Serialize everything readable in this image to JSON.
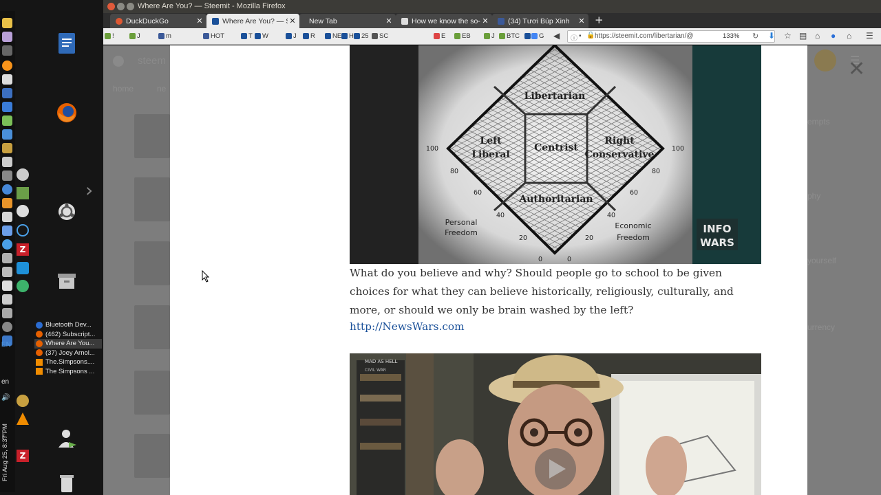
{
  "window": {
    "title": "Where Are You? — Steemit - Mozilla Firefox"
  },
  "tabs": [
    {
      "label": "DuckDuckGo",
      "favicon_color": "#de5833",
      "active": false
    },
    {
      "label": "Where Are You? — Ste",
      "favicon_color": "#1a5099",
      "active": true
    },
    {
      "label": "New Tab",
      "favicon_color": "",
      "active": false
    },
    {
      "label": "How we know the so-c",
      "favicon_color": "#dddddd",
      "active": false
    },
    {
      "label": "(34) Tươi Búp Xinh",
      "favicon_color": "#3b5998",
      "active": false
    }
  ],
  "bookmarks": [
    "!",
    "J",
    "m",
    "HOT",
    "T",
    "W",
    "J",
    "R",
    "NEW",
    "H",
    "25",
    "SC",
    "E",
    "EB",
    "J",
    "BTC",
    "G",
    "G"
  ],
  "urlbar": {
    "url": "https://steemit.com/libertarian/@",
    "zoom": "133%"
  },
  "post": {
    "paragraph": "What do you believe and why? Should people go to school to be given choices for what they can believe historically, religiously, culturally, and more, or should we only be brain washed by the left?",
    "link": "http://NewsWars.com"
  },
  "figure1": {
    "top_label": "Libertarian",
    "left_label_1": "Left",
    "left_label_2": "Liberal",
    "center_label": "Centrist",
    "right_label_1": "Right",
    "right_label_2": "Conservative",
    "bottom_label": "Authoritarian",
    "personal_1": "Personal",
    "personal_2": "Freedom",
    "economic_1": "Economic",
    "economic_2": "Freedom",
    "n100": "100",
    "n80": "80",
    "n60": "60",
    "n40": "40",
    "n20": "20",
    "n0": "0",
    "logo_1": "INFO",
    "logo_2": "WARS"
  },
  "figure2": {
    "sign_text": "MAD AS HELL",
    "sign_sub": "CIVIL WAR"
  },
  "window_list": [
    {
      "label": "Bluetooth Dev...",
      "color": "#2b6cd1",
      "active": false
    },
    {
      "label": "(462) Subscript...",
      "color": "#e66000",
      "active": false
    },
    {
      "label": "Where Are You...",
      "color": "#e66000",
      "active": true
    },
    {
      "label": "(37) Joey Arnol...",
      "color": "#e66000",
      "active": false
    },
    {
      "label": "The.Simpsons....",
      "color": "#f08c00",
      "active": false
    },
    {
      "label": "The Simpsons ...",
      "color": "#f08c00",
      "active": false
    }
  ],
  "tray": {
    "keyboard": "EN",
    "lang": "en",
    "clock": "Fri Aug 25, 8:37 PM"
  },
  "background_partial_text": {
    "nav_1": "home",
    "nav_2": "ne",
    "brand": "steem",
    "r1": "empts",
    "r2": "phy",
    "r3": "yourself",
    "r4": "urrency"
  }
}
